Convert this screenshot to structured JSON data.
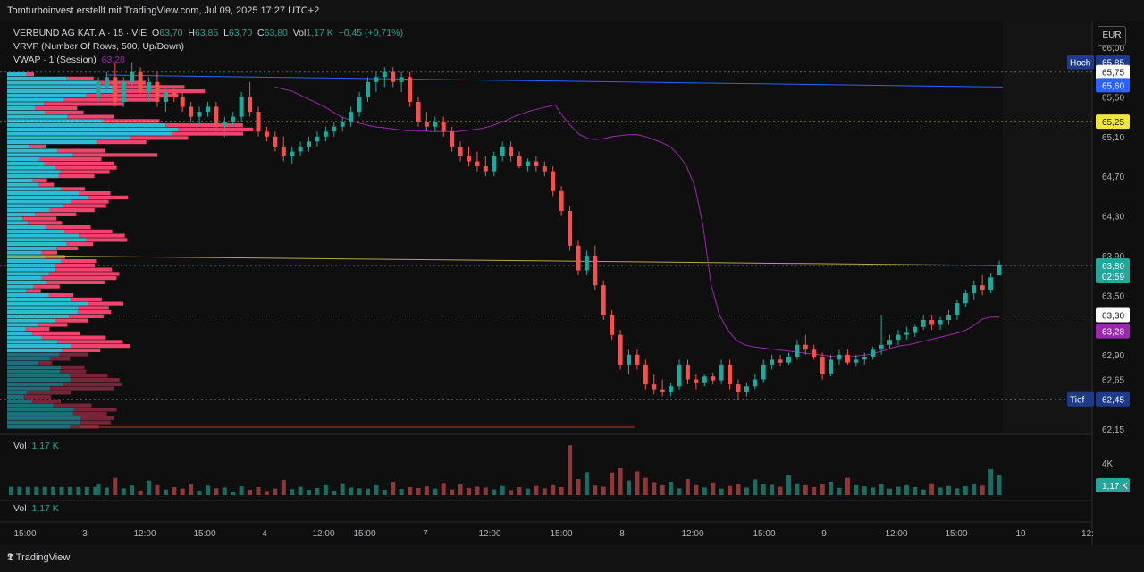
{
  "header": {
    "caption": "Tomturboinvest erstellt mit TradingView.com, Jul 09, 2025 17:27 UTC+2"
  },
  "legend": {
    "symbol": "VERBUND AG KAT. A · 15 · VIE",
    "open_label": "O",
    "open": "63,70",
    "high_label": "H",
    "high": "63,85",
    "low_label": "L",
    "low": "63,70",
    "close_label": "C",
    "close": "63,80",
    "vol_label": "Vol",
    "vol": "1,17 K",
    "change": "+0,45 (+0,71%)",
    "vrvp": "VRVP (Number Of Rows, 500, Up/Down)",
    "vwap_label": "VWAP · 1 (Session)",
    "vwap_value": "63,28"
  },
  "currency": "EUR",
  "price_badges": {
    "hoch_label": "Hoch",
    "hoch": "65,85",
    "line1": "65,75",
    "blue": "65,60",
    "yellow": "65,25",
    "last": "63,80",
    "countdown": "02:59",
    "line2": "63,30",
    "vwap": "63,28",
    "tief_label": "Tief",
    "tief": "62,45"
  },
  "volume_pane": {
    "label": "Vol",
    "value": "1,17 K",
    "axis_label": "4K",
    "badge": "1,17 K"
  },
  "second_pane": {
    "label": "Vol",
    "value": "1,17 K"
  },
  "time_axis": [
    "15:00",
    "3",
    "12:00",
    "15:00",
    "4",
    "12:00",
    "15:00",
    "7",
    "12:00",
    "15:00",
    "8",
    "12:00",
    "15:00",
    "9",
    "12:00",
    "15:00",
    "10",
    "12:"
  ],
  "footer": {
    "brand": "TradingView"
  },
  "colors": {
    "up": "#26a69a",
    "down": "#ef5350",
    "vwap": "#9c27b0",
    "blue_line": "#2962ff",
    "yellow_line": "#f0e442",
    "vrvp_up": "#2dbcd1",
    "vrvp_down": "#f0446e"
  },
  "chart_data": {
    "type": "candlestick",
    "y_ticks": [
      "66,00",
      "65,50",
      "65,10",
      "64,70",
      "64,30",
      "63,90",
      "63,50",
      "62,90",
      "62,65",
      "62,15"
    ],
    "ylim": [
      62.15,
      66.0
    ],
    "candles": [
      [
        65.5,
        65.7,
        65.45,
        65.65
      ],
      [
        65.6,
        65.75,
        65.55,
        65.7
      ],
      [
        65.7,
        65.85,
        65.4,
        65.45
      ],
      [
        65.45,
        65.7,
        65.4,
        65.65
      ],
      [
        65.65,
        65.85,
        65.55,
        65.75
      ],
      [
        65.75,
        65.8,
        65.5,
        65.55
      ],
      [
        65.55,
        65.7,
        65.45,
        65.65
      ],
      [
        65.65,
        65.75,
        65.4,
        65.45
      ],
      [
        65.45,
        65.6,
        65.35,
        65.55
      ],
      [
        65.55,
        65.6,
        65.45,
        65.5
      ],
      [
        65.5,
        65.55,
        65.35,
        65.4
      ],
      [
        65.4,
        65.45,
        65.25,
        65.3
      ],
      [
        65.3,
        65.4,
        65.2,
        65.35
      ],
      [
        65.35,
        65.45,
        65.3,
        65.4
      ],
      [
        65.4,
        65.45,
        65.15,
        65.2
      ],
      [
        65.2,
        65.3,
        65.1,
        65.25
      ],
      [
        65.25,
        65.35,
        65.2,
        65.3
      ],
      [
        65.3,
        65.55,
        65.25,
        65.5
      ],
      [
        65.5,
        65.65,
        65.3,
        65.35
      ],
      [
        65.35,
        65.4,
        65.1,
        65.15
      ],
      [
        65.15,
        65.2,
        65.05,
        65.1
      ],
      [
        65.1,
        65.15,
        64.95,
        65.0
      ],
      [
        65.0,
        65.1,
        64.85,
        64.9
      ],
      [
        64.9,
        65.0,
        64.82,
        64.95
      ],
      [
        64.95,
        65.05,
        64.9,
        65.0
      ],
      [
        65.0,
        65.1,
        64.95,
        65.05
      ],
      [
        65.05,
        65.15,
        65.0,
        65.1
      ],
      [
        65.1,
        65.2,
        65.05,
        65.15
      ],
      [
        65.15,
        65.25,
        65.1,
        65.2
      ],
      [
        65.2,
        65.3,
        65.15,
        65.25
      ],
      [
        65.25,
        65.4,
        65.2,
        65.35
      ],
      [
        65.35,
        65.55,
        65.3,
        65.5
      ],
      [
        65.5,
        65.7,
        65.45,
        65.65
      ],
      [
        65.65,
        65.75,
        65.55,
        65.7
      ],
      [
        65.7,
        65.8,
        65.6,
        65.75
      ],
      [
        65.75,
        65.8,
        65.6,
        65.65
      ],
      [
        65.65,
        65.75,
        65.55,
        65.7
      ],
      [
        65.7,
        65.75,
        65.4,
        65.45
      ],
      [
        65.45,
        65.5,
        65.2,
        65.25
      ],
      [
        65.25,
        65.35,
        65.15,
        65.2
      ],
      [
        65.2,
        65.3,
        65.15,
        65.25
      ],
      [
        65.25,
        65.3,
        65.1,
        65.15
      ],
      [
        65.15,
        65.2,
        64.95,
        65.0
      ],
      [
        65.0,
        65.05,
        64.85,
        64.9
      ],
      [
        64.9,
        65.0,
        64.8,
        64.85
      ],
      [
        64.85,
        64.95,
        64.75,
        64.8
      ],
      [
        64.8,
        64.9,
        64.7,
        64.75
      ],
      [
        64.75,
        64.95,
        64.7,
        64.9
      ],
      [
        64.9,
        65.05,
        64.85,
        65.0
      ],
      [
        65.0,
        65.05,
        64.85,
        64.9
      ],
      [
        64.9,
        64.95,
        64.78,
        64.8
      ],
      [
        64.8,
        64.88,
        64.75,
        64.85
      ],
      [
        64.85,
        64.9,
        64.75,
        64.8
      ],
      [
        64.8,
        64.85,
        64.7,
        64.75
      ],
      [
        64.75,
        64.8,
        64.5,
        64.55
      ],
      [
        64.55,
        64.6,
        64.3,
        64.35
      ],
      [
        64.35,
        64.4,
        63.95,
        64.0
      ],
      [
        64.0,
        64.05,
        63.7,
        63.75
      ],
      [
        63.75,
        63.95,
        63.7,
        63.9
      ],
      [
        63.9,
        64.0,
        63.55,
        63.6
      ],
      [
        63.6,
        63.65,
        63.25,
        63.3
      ],
      [
        63.3,
        63.35,
        63.05,
        63.1
      ],
      [
        63.1,
        63.15,
        62.75,
        62.8
      ],
      [
        62.8,
        62.95,
        62.7,
        62.9
      ],
      [
        62.9,
        62.95,
        62.75,
        62.8
      ],
      [
        62.8,
        62.85,
        62.55,
        62.6
      ],
      [
        62.6,
        62.7,
        62.5,
        62.55
      ],
      [
        62.55,
        62.65,
        62.48,
        62.52
      ],
      [
        62.52,
        62.62,
        62.48,
        62.58
      ],
      [
        62.58,
        62.85,
        62.55,
        62.8
      ],
      [
        62.8,
        62.85,
        62.6,
        62.65
      ],
      [
        62.65,
        62.7,
        62.55,
        62.62
      ],
      [
        62.62,
        62.7,
        62.58,
        62.68
      ],
      [
        62.68,
        62.72,
        62.6,
        62.64
      ],
      [
        62.64,
        62.85,
        62.6,
        62.8
      ],
      [
        62.8,
        62.85,
        62.55,
        62.6
      ],
      [
        62.6,
        62.65,
        62.45,
        62.52
      ],
      [
        62.52,
        62.62,
        62.48,
        62.58
      ],
      [
        62.58,
        62.7,
        62.55,
        62.65
      ],
      [
        62.65,
        62.85,
        62.62,
        62.8
      ],
      [
        62.8,
        62.9,
        62.75,
        62.85
      ],
      [
        62.85,
        62.9,
        62.78,
        62.82
      ],
      [
        62.82,
        62.92,
        62.8,
        62.88
      ],
      [
        62.88,
        63.05,
        62.85,
        63.0
      ],
      [
        63.0,
        63.1,
        62.9,
        62.95
      ],
      [
        62.95,
        63.0,
        62.85,
        62.88
      ],
      [
        62.88,
        62.92,
        62.65,
        62.7
      ],
      [
        62.7,
        62.9,
        62.68,
        62.85
      ],
      [
        62.85,
        62.95,
        62.8,
        62.9
      ],
      [
        62.9,
        62.95,
        62.8,
        62.82
      ],
      [
        62.82,
        62.9,
        62.78,
        62.85
      ],
      [
        62.85,
        62.92,
        62.8,
        62.88
      ],
      [
        62.88,
        62.98,
        62.85,
        62.95
      ],
      [
        62.95,
        63.3,
        62.9,
        63.0
      ],
      [
        63.0,
        63.1,
        62.95,
        63.05
      ],
      [
        63.05,
        63.15,
        63.0,
        63.1
      ],
      [
        63.1,
        63.18,
        63.05,
        63.12
      ],
      [
        63.12,
        63.2,
        63.08,
        63.18
      ],
      [
        63.18,
        63.3,
        63.15,
        63.25
      ],
      [
        63.25,
        63.3,
        63.15,
        63.2
      ],
      [
        63.2,
        63.28,
        63.15,
        63.25
      ],
      [
        63.25,
        63.35,
        63.2,
        63.3
      ],
      [
        63.3,
        63.45,
        63.25,
        63.42
      ],
      [
        63.42,
        63.55,
        63.38,
        63.52
      ],
      [
        63.52,
        63.65,
        63.45,
        63.6
      ],
      [
        63.6,
        63.7,
        63.5,
        63.55
      ],
      [
        63.55,
        63.72,
        63.52,
        63.68
      ],
      [
        63.7,
        63.85,
        63.7,
        63.8
      ]
    ],
    "volumes": [
      300,
      200,
      450,
      180,
      250,
      120,
      380,
      260,
      150,
      210,
      170,
      300,
      120,
      250,
      180,
      200,
      90,
      230,
      140,
      210,
      110,
      170,
      400,
      160,
      220,
      140,
      190,
      260,
      120,
      310,
      200,
      180,
      170,
      260,
      140,
      350,
      160,
      210,
      190,
      230,
      170,
      320,
      150,
      280,
      190,
      220,
      200,
      150,
      240,
      130,
      210,
      170,
      240,
      180,
      260,
      210,
      1300,
      420,
      600,
      250,
      220,
      590,
      700,
      380,
      620,
      450,
      340,
      260,
      350,
      180,
      420,
      260,
      200,
      330,
      170,
      240,
      300,
      200,
      410,
      290,
      270,
      220,
      510,
      310,
      260,
      210,
      280,
      350,
      190,
      450,
      260,
      230,
      200,
      300,
      170,
      220,
      260,
      210,
      150,
      310,
      200,
      240,
      180,
      230,
      290,
      250,
      680,
      520,
      390,
      270,
      600,
      330
    ],
    "vwap": [
      65.6,
      65.58,
      65.56,
      65.52,
      65.48,
      65.44,
      65.4,
      65.35,
      65.3,
      65.27,
      65.24,
      65.22,
      65.2,
      65.19,
      65.18,
      65.17,
      65.16,
      65.16,
      65.16,
      65.15,
      65.15,
      65.15,
      65.15,
      65.16,
      65.17,
      65.18,
      65.2,
      65.23,
      65.26,
      65.3,
      65.33,
      65.36,
      65.38,
      65.4,
      65.42,
      65.3,
      65.2,
      65.12,
      65.08,
      65.07,
      65.08,
      65.1,
      65.11,
      65.12,
      65.12,
      65.1,
      65.07,
      65.04,
      65.0,
      64.92,
      64.8,
      64.6,
      64.2,
      63.6,
      63.3,
      63.15,
      63.05,
      63.0,
      62.98,
      62.97,
      62.96,
      62.95,
      62.94,
      62.93,
      62.92,
      62.91,
      62.9,
      62.89,
      62.88,
      62.88,
      62.88,
      62.89,
      62.9,
      62.92,
      62.94,
      62.97,
      62.99,
      63.0,
      63.02,
      63.04,
      63.06,
      63.08,
      63.1,
      63.12,
      63.15,
      63.2,
      63.26,
      63.28,
      63.28
    ],
    "vwap_start_index": 21,
    "blue_line": {
      "from": 65.72,
      "to": 65.6
    },
    "yellow_line": {
      "from": 63.9,
      "to": 63.8
    }
  }
}
